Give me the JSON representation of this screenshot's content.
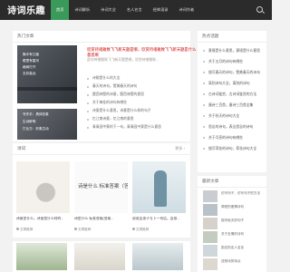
{
  "header": {
    "logo": "诗词乐趣",
    "nav": [
      "首页",
      "诗词解析",
      "诗词大全",
      "名人名言",
      "经典语录",
      "诗词作者",
      "诗词名句"
    ]
  },
  "hot": {
    "title": "热门文章",
    "image1_lines": [
      "胸中有丘壑",
      "眼里有星河",
      "格局打开",
      "志存高远"
    ],
    "image2_lines": [
      "写作手：具体形象",
      "生动鲜明",
      "打比方：形象生动"
    ],
    "featured_title": "欣赏待诸雅致飞飞新天题是哪，欣赏待诸雅致飞飞新天题是什么意思啊",
    "featured_summary": "此句待诸雅致飞飞新天题是哪，欣赏待诸雅致...",
    "items": [
      "诗歌是什么的大全",
      "春天的诗句，赞美春天的诗句",
      "题西林壁的诗意，题西林壁的意思",
      "关于梅花的诗句有哪些",
      "诗意是什么意思，诗意是什么样的句子",
      "忆江南诗意，忆江南的意思",
      "青青园中葵的下一句，青青园中葵是什么意思"
    ]
  },
  "articles": {
    "title": "诗词",
    "more": "更多 ›",
    "cards": [
      {
        "title": "诗意是什么，诗意是什么样的...",
        "tag": "文章推荐"
      },
      {
        "title": "诗是什么 标准答案(答案...",
        "tag": "文章推荐"
      },
      {
        "title": "说说女孩子写下一句话，女孩...",
        "tag": "文章推荐"
      }
    ],
    "card2_overlay": "诗是什么 标准答案（答"
  },
  "sidebar": {
    "box1_title": "热点话题",
    "box1_items": [
      "意境是什么意思，意境是什么意思",
      "关于五月的诗句有哪些",
      "描写春天的诗句，赞美春天的诗句",
      "离别诗句大全，离别的诗句",
      "古诗词鉴赏，古诗词鉴赏的方法",
      "唐诗三百首，唐诗三百首全集",
      "关于秋天的诗句大全",
      "思念的诗句，表达思念的诗句",
      "关于月亮的诗句有哪些",
      "描写荷花的诗句，荷花诗句大全"
    ],
    "box2_title": "最新文章",
    "box2_items": [
      "仿写句子，仿写句子的方法",
      "简短的爱情诗句",
      "描写秋天的句子",
      "关于友情的诗句",
      "励志的名人名言",
      "送别诗的特点"
    ]
  },
  "colors": {
    "nav_bg": "#2b2b2b",
    "nav_active": "#3a9a5a",
    "featured": "#cc0000"
  }
}
